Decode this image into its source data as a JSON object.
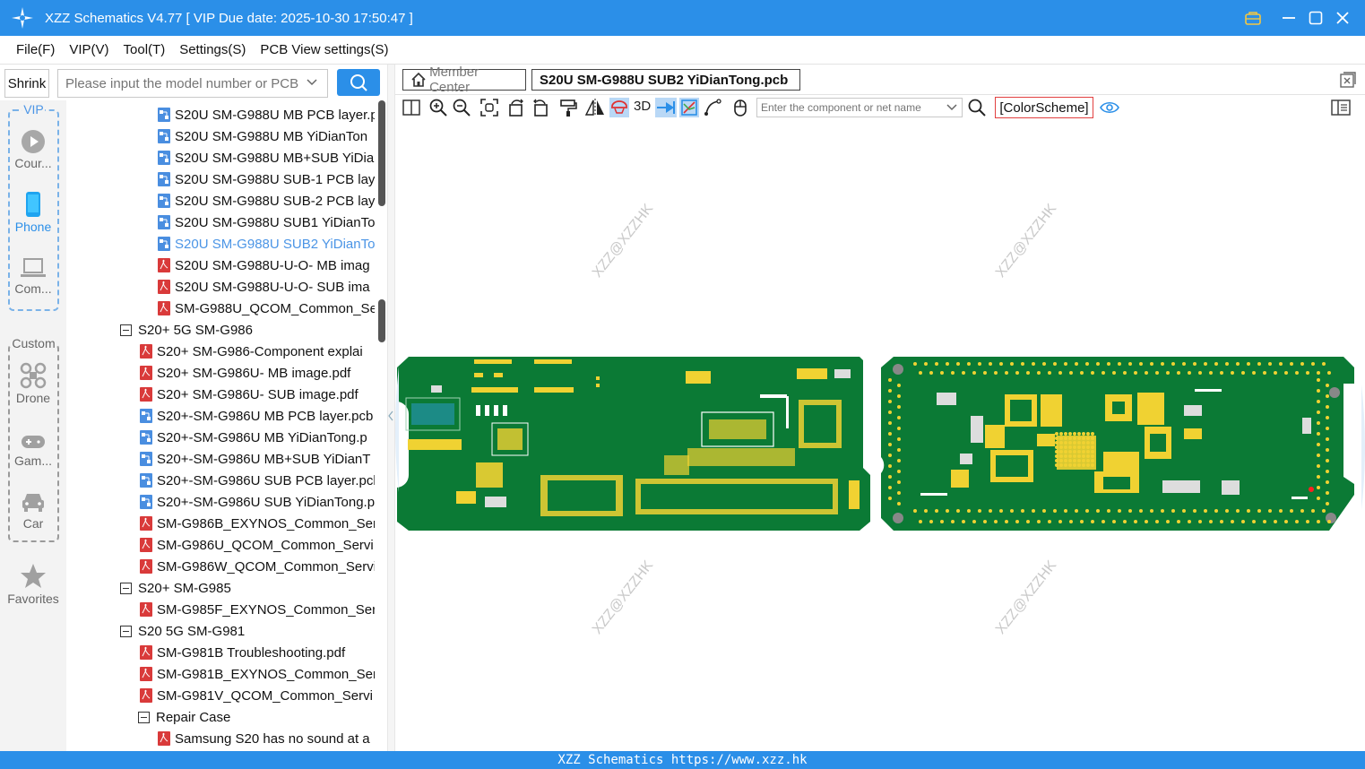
{
  "window": {
    "title": "XZZ Schematics V4.77 [ VIP Due date: 2025-10-30 17:50:47 ]",
    "icons": [
      "vip-icon",
      "minimize-icon",
      "maximize-icon",
      "close-icon"
    ]
  },
  "menu": [
    "File(F)",
    "VIP(V)",
    "Tool(T)",
    "Settings(S)",
    "PCB View settings(S)"
  ],
  "search": {
    "shrink_label": "Shrink",
    "placeholder": "Please input the model number or PCB",
    "value": ""
  },
  "nav": {
    "vip_label": "VIP",
    "custom_label": "Custom",
    "items": [
      {
        "label": "Cour...",
        "icon": "play-circle-icon"
      },
      {
        "label": "Phone",
        "icon": "phone-icon",
        "active": true
      },
      {
        "label": "Com...",
        "icon": "laptop-icon"
      },
      {
        "label": "Drone",
        "icon": "drone-icon"
      },
      {
        "label": "Gam...",
        "icon": "gamepad-icon"
      },
      {
        "label": "Car",
        "icon": "car-icon"
      },
      {
        "label": "Favorites",
        "icon": "star-icon"
      }
    ]
  },
  "tree": [
    {
      "label": "S20U SM-G988U MB PCB layer.p",
      "type": "pcb",
      "indent": 2
    },
    {
      "label": "S20U SM-G988U MB YiDianTon",
      "type": "pcb",
      "indent": 2
    },
    {
      "label": "S20U SM-G988U MB+SUB YiDia",
      "type": "pcb",
      "indent": 2
    },
    {
      "label": "S20U SM-G988U SUB-1 PCB laye",
      "type": "pcb",
      "indent": 2
    },
    {
      "label": "S20U SM-G988U SUB-2 PCB laye",
      "type": "pcb",
      "indent": 2
    },
    {
      "label": "S20U SM-G988U SUB1 YiDianTo",
      "type": "pcb",
      "indent": 2
    },
    {
      "label": "S20U SM-G988U SUB2 YiDianTo",
      "type": "pcb",
      "indent": 2,
      "selected": true
    },
    {
      "label": "S20U SM-G988U-U-O- MB imag",
      "type": "pdf",
      "indent": 2
    },
    {
      "label": "S20U SM-G988U-U-O- SUB ima",
      "type": "pdf",
      "indent": 2
    },
    {
      "label": "SM-G988U_QCOM_Common_Se",
      "type": "pdf",
      "indent": 2
    },
    {
      "label": "S20+ 5G SM-G986",
      "type": "folder",
      "indent": 0
    },
    {
      "label": "S20+ SM-G986-Component explai",
      "type": "pdf",
      "indent": 1
    },
    {
      "label": "S20+ SM-G986U- MB image.pdf",
      "type": "pdf",
      "indent": 1
    },
    {
      "label": "S20+ SM-G986U- SUB image.pdf",
      "type": "pdf",
      "indent": 1
    },
    {
      "label": "S20+-SM-G986U MB PCB layer.pcb",
      "type": "pcb",
      "indent": 1
    },
    {
      "label": "S20+-SM-G986U MB YiDianTong.p",
      "type": "pcb",
      "indent": 1
    },
    {
      "label": "S20+-SM-G986U MB+SUB YiDianT",
      "type": "pcb",
      "indent": 1
    },
    {
      "label": "S20+-SM-G986U SUB PCB layer.pcl",
      "type": "pcb",
      "indent": 1
    },
    {
      "label": "S20+-SM-G986U SUB YiDianTong.p",
      "type": "pcb",
      "indent": 1
    },
    {
      "label": "SM-G986B_EXYNOS_Common_Serv",
      "type": "pdf",
      "indent": 1
    },
    {
      "label": "SM-G986U_QCOM_Common_Servi",
      "type": "pdf",
      "indent": 1
    },
    {
      "label": "SM-G986W_QCOM_Common_Servi",
      "type": "pdf",
      "indent": 1
    },
    {
      "label": "S20+ SM-G985",
      "type": "folder",
      "indent": 0
    },
    {
      "label": "SM-G985F_EXYNOS_Common_Serv",
      "type": "pdf",
      "indent": 1
    },
    {
      "label": "S20 5G SM-G981",
      "type": "folder",
      "indent": 0
    },
    {
      "label": "SM-G981B Troubleshooting.pdf",
      "type": "pdf",
      "indent": 1
    },
    {
      "label": "SM-G981B_EXYNOS_Common_Serv",
      "type": "pdf",
      "indent": 1
    },
    {
      "label": "SM-G981V_QCOM_Common_Servi",
      "type": "pdf",
      "indent": 1
    },
    {
      "label": "Repair Case",
      "type": "folder",
      "indent": 1
    },
    {
      "label": "Samsung S20 has no sound at a",
      "type": "pdf",
      "indent": 2
    }
  ],
  "tabs": {
    "member_center": "Member Center",
    "active": "S20U SM-G988U SUB2 YiDianTong.pcb"
  },
  "toolbar": {
    "label_3d": "3D",
    "component_placeholder": "Enter the component or net name",
    "colorscheme": "[ColorScheme]"
  },
  "canvas": {
    "watermark": "XZZ@XZZHK",
    "board_color": "#0b7a35",
    "pad_color": "#f0d232"
  },
  "status": "XZZ Schematics https://www.xzz.hk",
  "colors": {
    "accent": "#2b8fe8",
    "selected_text": "#4b95e6",
    "pdf_icon": "#d93a3a",
    "pcb_icon": "#4a8ee0"
  }
}
